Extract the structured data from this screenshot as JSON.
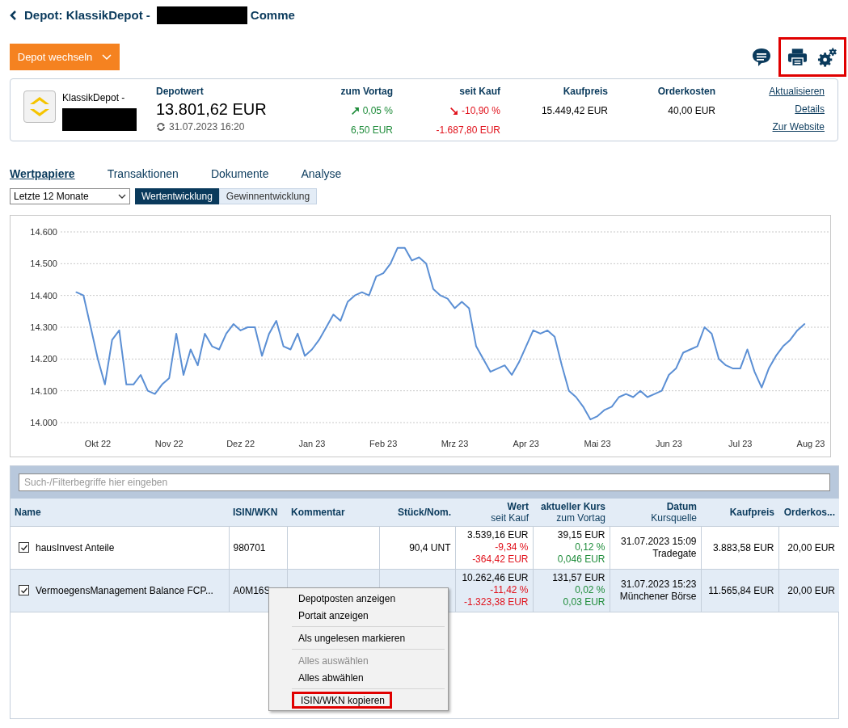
{
  "header": {
    "title_prefix": "Depot: KlassikDepot -",
    "title_suffix": "Comme",
    "switch_button": "Depot wechseln"
  },
  "summary": {
    "depot_name": "KlassikDepot -",
    "value_label": "Depotwert",
    "value": "13.801,62 EUR",
    "timestamp": "31.07.2023 16:20",
    "stats": [
      {
        "label": "zum Vortag",
        "pct": "0,05 %",
        "amount": "6,50 EUR",
        "gain": true
      },
      {
        "label": "seit Kauf",
        "pct": "-10,90 %",
        "amount": "-1.687,80 EUR",
        "gain": false
      }
    ],
    "plain_stats": [
      {
        "label": "Kaufpreis",
        "value": "15.449,42 EUR"
      },
      {
        "label": "Orderkosten",
        "value": "40,00 EUR"
      }
    ],
    "links": [
      "Aktualisieren",
      "Details",
      "Zur Website"
    ]
  },
  "tabs": [
    {
      "label": "Wertpapiere",
      "selected": true
    },
    {
      "label": "Transaktionen",
      "selected": false
    },
    {
      "label": "Dokumente",
      "selected": false
    },
    {
      "label": "Analyse",
      "selected": false
    }
  ],
  "period_select": "Letzte 12 Monate",
  "view_toggle": [
    {
      "label": "Wertentwicklung",
      "selected": true
    },
    {
      "label": "Gewinnentwicklung",
      "selected": false
    }
  ],
  "chart": {
    "chart_data": {
      "type": "line",
      "grid": true,
      "ylim": [
        14000,
        14600
      ],
      "yticks": [
        {
          "value": 14000,
          "label": "14.000"
        },
        {
          "value": 14100,
          "label": "14.100"
        },
        {
          "value": 14200,
          "label": "14.200"
        },
        {
          "value": 14300,
          "label": "14.300"
        },
        {
          "value": 14400,
          "label": "14.400"
        },
        {
          "value": 14500,
          "label": "14.500"
        },
        {
          "value": 14600,
          "label": "14.600"
        }
      ],
      "categories": [
        null,
        null,
        null,
        "Okt 22",
        null,
        null,
        null,
        null,
        null,
        null,
        null,
        null,
        null,
        "Nov 22",
        null,
        null,
        null,
        null,
        null,
        null,
        null,
        null,
        null,
        "Dez 22",
        null,
        null,
        null,
        null,
        null,
        null,
        null,
        null,
        null,
        "Jan 23",
        null,
        null,
        null,
        null,
        null,
        null,
        null,
        null,
        null,
        "Feb 23",
        null,
        null,
        null,
        null,
        null,
        null,
        null,
        null,
        null,
        "Mrz 23",
        null,
        null,
        null,
        null,
        null,
        null,
        null,
        null,
        null,
        "Apr 23",
        null,
        null,
        null,
        null,
        null,
        null,
        null,
        null,
        null,
        "Mai 23",
        null,
        null,
        null,
        null,
        null,
        null,
        null,
        null,
        null,
        "Jun 23",
        null,
        null,
        null,
        null,
        null,
        null,
        null,
        null,
        null,
        "Jul 23",
        null,
        null,
        null,
        null,
        null,
        null,
        null,
        null,
        null,
        "Aug 23"
      ],
      "series": [
        {
          "color": "#5b8fd4",
          "values": [
            14410,
            14400,
            14300,
            14200,
            14120,
            14260,
            14290,
            14120,
            14120,
            14150,
            14100,
            14090,
            14120,
            14140,
            14280,
            14150,
            14230,
            14180,
            14280,
            14240,
            14230,
            14280,
            14310,
            14290,
            14300,
            14300,
            14210,
            14280,
            14320,
            14240,
            14230,
            14280,
            14210,
            14230,
            14260,
            14300,
            14340,
            14320,
            14380,
            14400,
            14410,
            14400,
            14460,
            14470,
            14500,
            14550,
            14550,
            14510,
            14520,
            14500,
            14420,
            14400,
            14390,
            14360,
            14380,
            14360,
            14240,
            14200,
            14160,
            14170,
            14180,
            14150,
            14190,
            14240,
            14290,
            14280,
            14290,
            14270,
            14180,
            14100,
            14080,
            14050,
            14010,
            14020,
            14040,
            14050,
            14080,
            14090,
            14080,
            14100,
            14080,
            14090,
            14100,
            14150,
            14170,
            14220,
            14230,
            14240,
            14300,
            14280,
            14200,
            14180,
            14170,
            14170,
            14230,
            14160,
            14110,
            14170,
            14210,
            14240,
            14260,
            14290,
            14310,
            null
          ]
        }
      ]
    }
  },
  "filter": {
    "placeholder": "Such-/Filterbegriffe hier eingeben"
  },
  "table": {
    "columns": [
      {
        "title": "Name"
      },
      {
        "title": "ISIN/WKN"
      },
      {
        "title": "Kommentar"
      },
      {
        "title": "Stück/Nom."
      },
      {
        "title": "Wert",
        "subtitle": "seit Kauf"
      },
      {
        "title": "aktueller Kurs",
        "subtitle": "zum Vortag"
      },
      {
        "title": "Datum",
        "subtitle": "Kursquelle"
      },
      {
        "title": "Kaufpreis"
      },
      {
        "title": "Orderkos..."
      }
    ],
    "rows": [
      {
        "checked": true,
        "selected": false,
        "name": "hausInvest Anteile",
        "isin": "980701",
        "units": "90,4 UNT",
        "value": {
          "main": "3.539,16 EUR",
          "pct": "-9,34 %",
          "amount": "-364,42 EUR",
          "gain": false
        },
        "price": {
          "main": "39,15 EUR",
          "pct": "0,12 %",
          "amount": "0,046 EUR",
          "gain": true
        },
        "date": "31.07.2023 15:09",
        "source": "Tradegate",
        "purchase": "3.883,58 EUR",
        "costs": "20,00 EUR"
      },
      {
        "checked": true,
        "selected": true,
        "name": "VermoegensManagement Balance FCP...",
        "isin": "A0M16S",
        "value": {
          "main": "10.262,46 EUR",
          "pct": "-11,42 %",
          "amount": "-1.323,38 EUR",
          "gain": false
        },
        "price": {
          "main": "131,57 EUR",
          "pct": "0,02 %",
          "amount": "0,03 EUR",
          "gain": true
        },
        "date": "31.07.2023 15:23",
        "source": "Münchener Börse",
        "purchase": "11.565,84 EUR",
        "costs": "20,00 EUR"
      }
    ]
  },
  "context_menu": [
    {
      "label": "Depotposten anzeigen",
      "separator_before": false,
      "disabled": false,
      "highlighted": false
    },
    {
      "label": "Portait anzeigen",
      "separator_before": false,
      "disabled": false,
      "highlighted": false
    },
    {
      "label": "Als ungelesen markieren",
      "separator_before": true,
      "disabled": false,
      "highlighted": false
    },
    {
      "label": "Alles auswählen",
      "separator_before": true,
      "disabled": true,
      "highlighted": false
    },
    {
      "label": "Alles abwählen",
      "separator_before": false,
      "disabled": false,
      "highlighted": false
    },
    {
      "label": "ISIN/WKN kopieren",
      "separator_before": true,
      "disabled": false,
      "highlighted": true
    }
  ]
}
